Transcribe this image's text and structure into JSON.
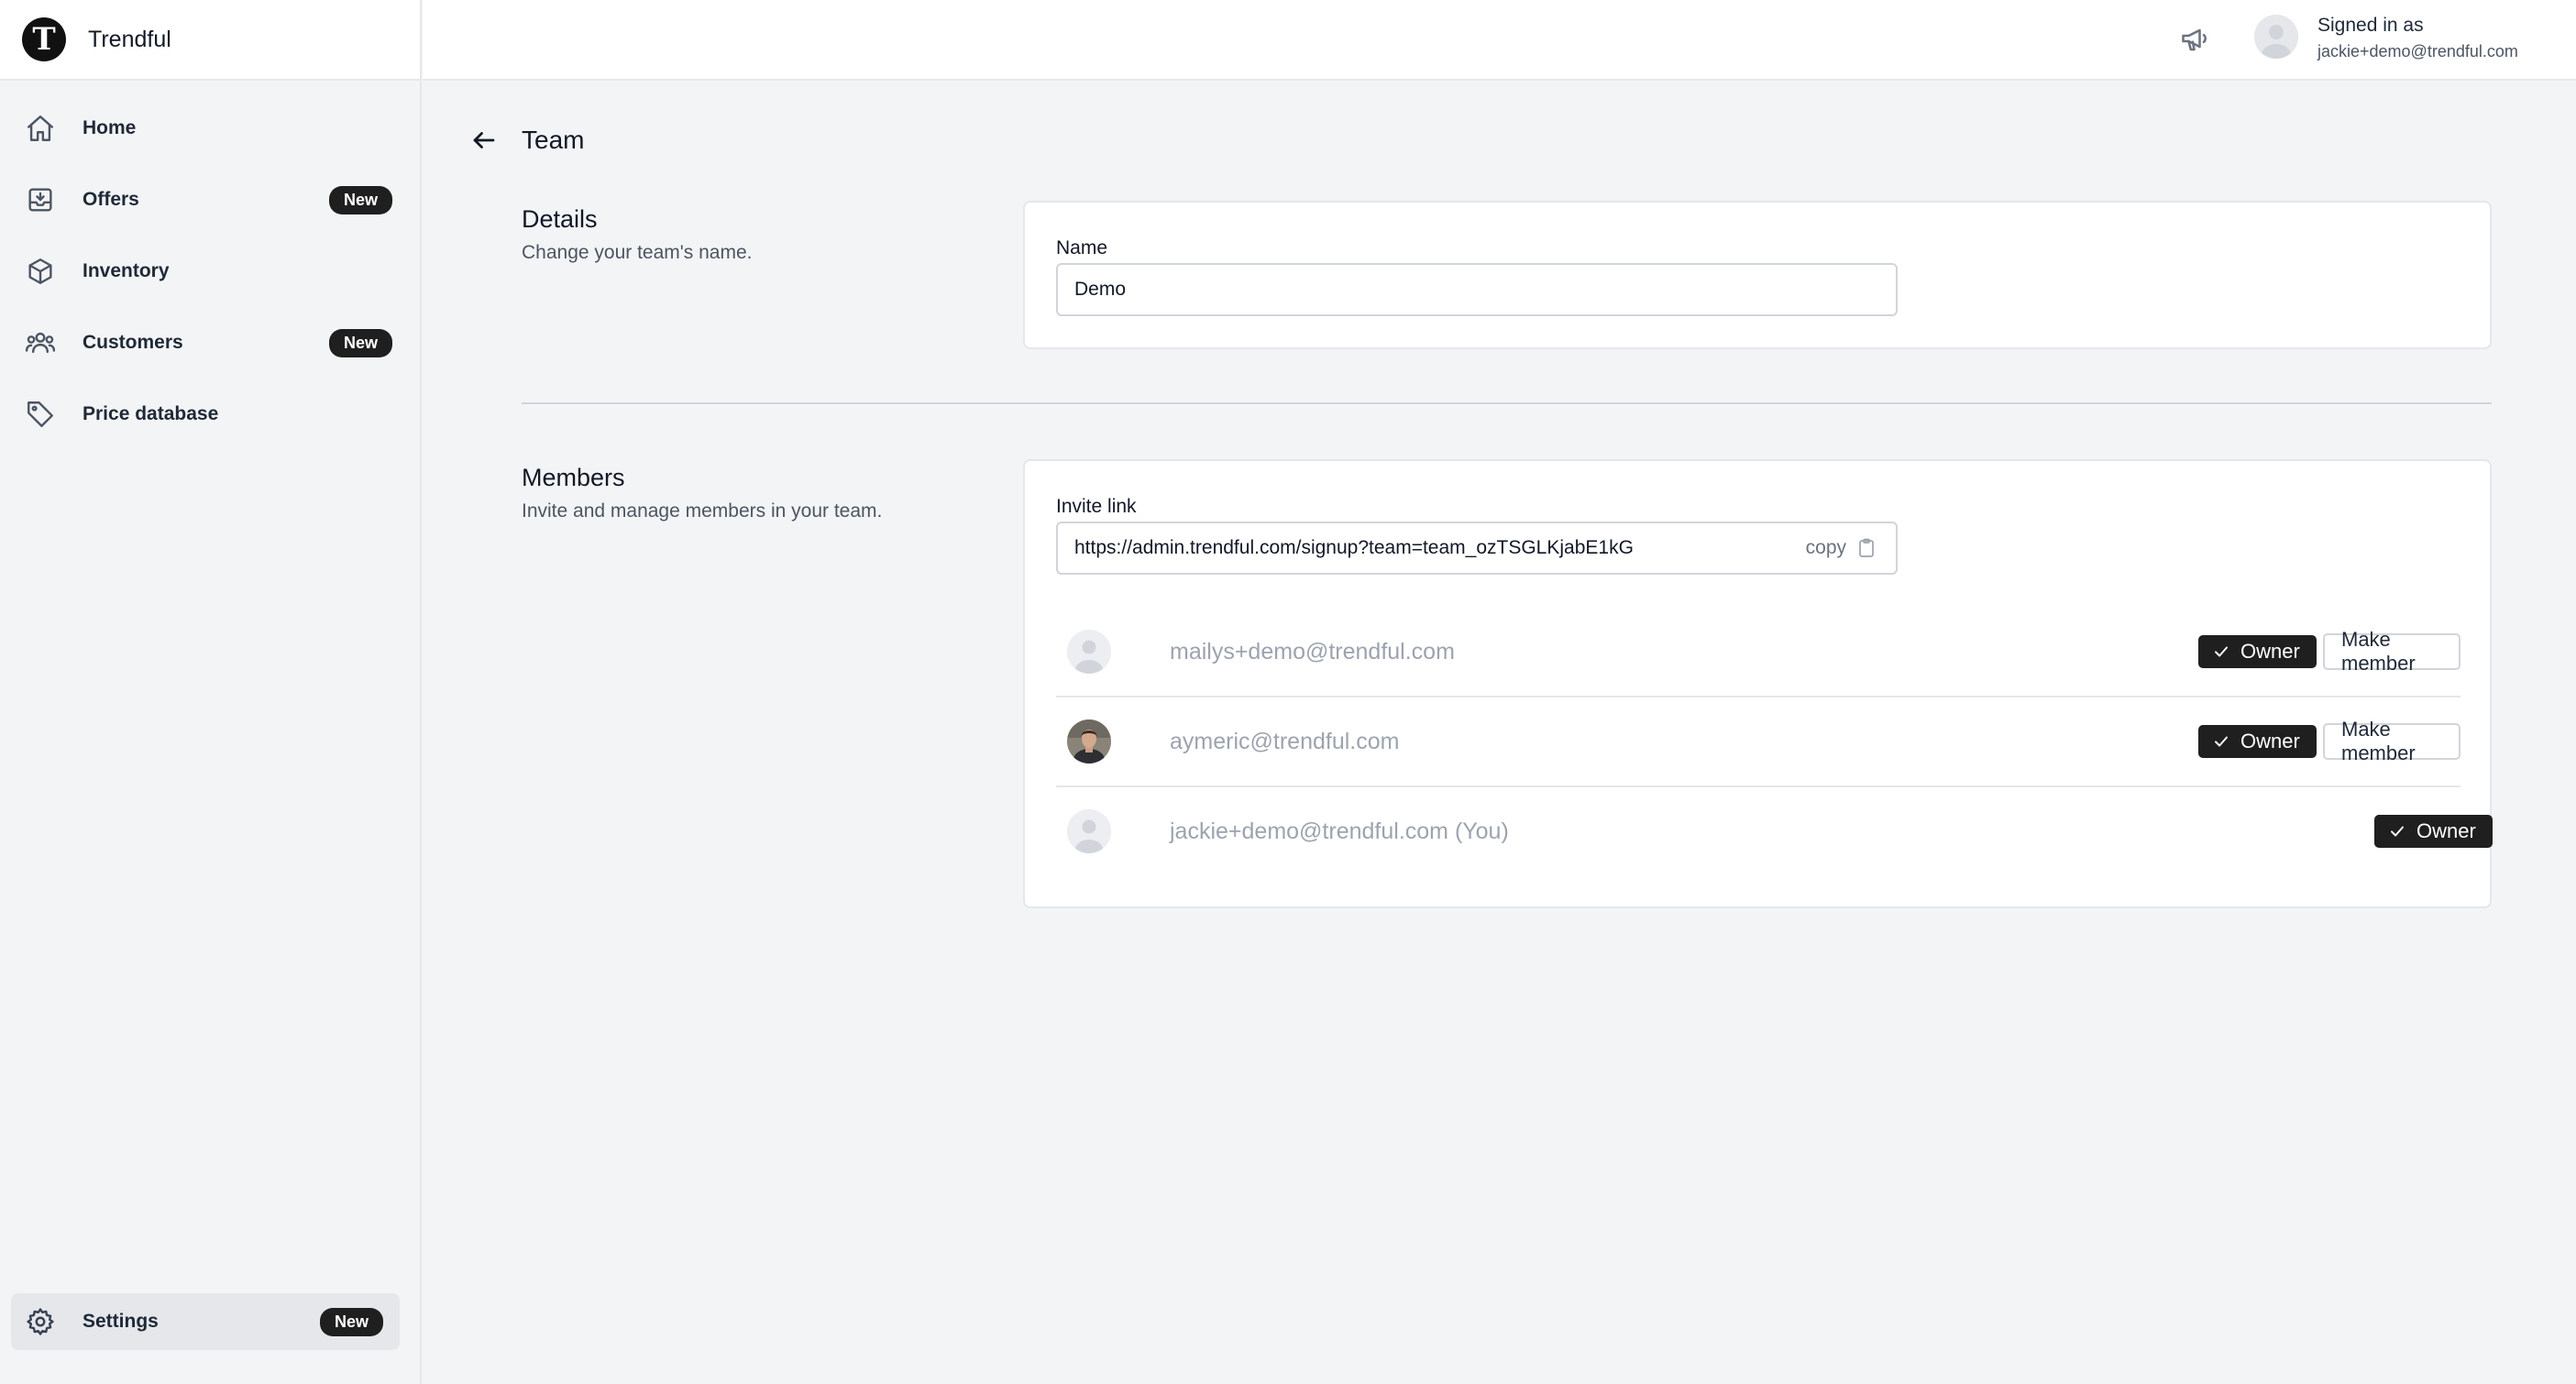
{
  "app": {
    "name": "Trendful",
    "logo_letter": "T"
  },
  "sidebar": {
    "items": [
      {
        "label": "Home",
        "icon": "home-icon",
        "badge": ""
      },
      {
        "label": "Offers",
        "icon": "inbox-download-icon",
        "badge": "New"
      },
      {
        "label": "Inventory",
        "icon": "cube-icon",
        "badge": ""
      },
      {
        "label": "Customers",
        "icon": "users-icon",
        "badge": "New"
      },
      {
        "label": "Price database",
        "icon": "tag-icon",
        "badge": ""
      }
    ],
    "settings": {
      "label": "Settings",
      "icon": "gear-icon",
      "badge": "New"
    }
  },
  "header": {
    "signed_in_label": "Signed in as",
    "user_email": "jackie+demo@trendful.com",
    "icons": [
      "megaphone-icon",
      "avatar-icon"
    ]
  },
  "page": {
    "title": "Team"
  },
  "details": {
    "title": "Details",
    "description": "Change your team's name.",
    "name_label": "Name",
    "name_value": "Demo"
  },
  "members": {
    "title": "Members",
    "description": "Invite and manage members in your team.",
    "invite_label": "Invite link",
    "invite_url": "https://admin.trendful.com/signup?team=team_ozTSGLKjabE1kG",
    "copy_label": "copy",
    "owner_label": "Owner",
    "make_member_label": "Make member",
    "list": [
      {
        "email": "mailys+demo@trendful.com",
        "role": "Owner",
        "action": "Make member",
        "avatar": "placeholder"
      },
      {
        "email": "aymeric@trendful.com",
        "role": "Owner",
        "action": "Make member",
        "avatar": "photo"
      },
      {
        "email": "jackie+demo@trendful.com (You)",
        "role": "Owner",
        "action": "",
        "avatar": "placeholder"
      }
    ]
  },
  "colors": {
    "accent": "#1f1f1f",
    "background": "#f3f4f6",
    "muted_text": "#9ca3af"
  }
}
